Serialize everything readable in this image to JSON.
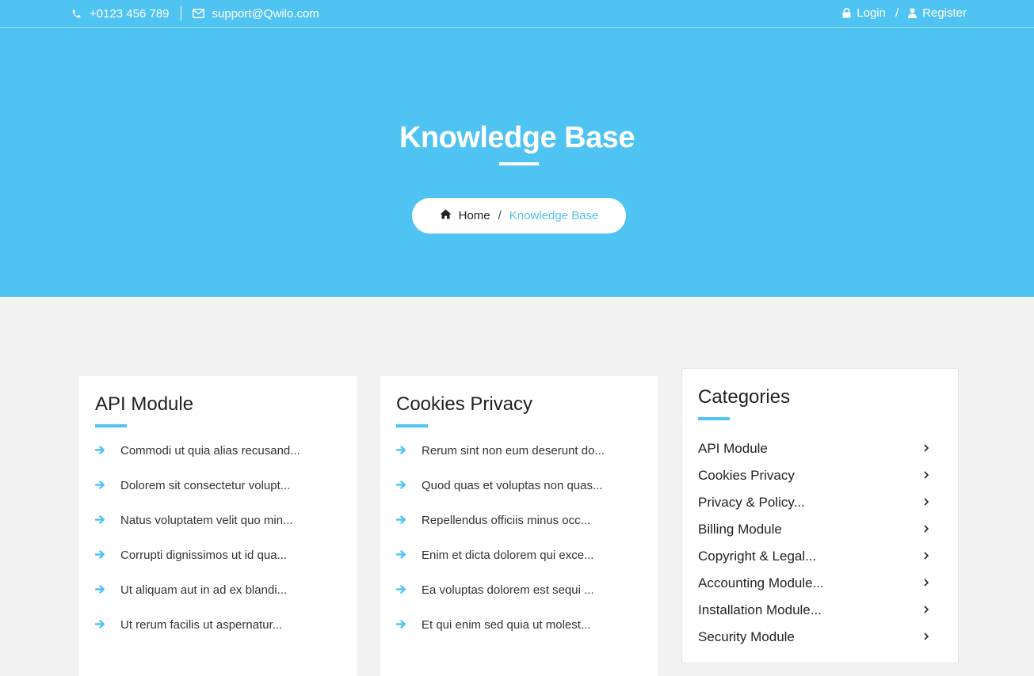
{
  "topbar": {
    "phone": "+0123 456 789",
    "email": "support@Qwilo.com",
    "login_label": "Login",
    "separator": "/",
    "register_label": "Register"
  },
  "hero": {
    "title": "Knowledge Base",
    "breadcrumb": {
      "home_label": "Home",
      "separator": "/",
      "current_label": "Knowledge Base"
    }
  },
  "cards": [
    {
      "title": "API Module",
      "items": [
        "Commodi ut quia alias recusand...",
        "Dolorem sit consectetur volupt...",
        "Natus voluptatem velit quo min...",
        "Corrupti dignissimos ut id qua...",
        "Ut aliquam aut in ad ex blandi...",
        "Ut rerum facilis ut aspernatur..."
      ]
    },
    {
      "title": "Cookies Privacy",
      "items": [
        "Rerum sint non eum deserunt do...",
        "Quod quas et voluptas non quas...",
        "Repellendus officiis minus occ...",
        "Enim et dicta dolorem qui exce...",
        "Ea voluptas dolorem est sequi ...",
        "Et qui enim sed quia ut molest..."
      ]
    }
  ],
  "categories": {
    "title": "Categories",
    "items": [
      "API Module",
      "Cookies Privacy",
      "Privacy & Policy...",
      "Billing Module",
      "Copyright & Legal...",
      "Accounting Module...",
      "Installation Module...",
      "Security Module"
    ]
  },
  "colors": {
    "accent": "#4fc3f2",
    "page_background": "#f2f2f2",
    "card_background": "#ffffff"
  },
  "icons": {
    "phone": "phone-icon",
    "email": "envelope-icon",
    "login": "lock-icon",
    "register": "user-icon",
    "home": "home-icon",
    "article": "arrow-right-icon",
    "category": "chevron-right-icon"
  }
}
